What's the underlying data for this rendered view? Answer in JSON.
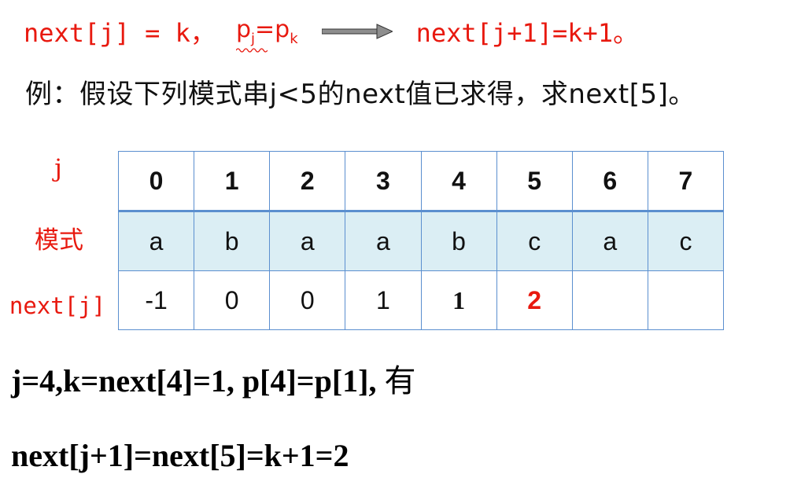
{
  "formula": {
    "left": "next[j] = k，",
    "p": "p",
    "j_sub": "j",
    "eq": "=p",
    "k_sub": "k",
    "right": "next[j+1]=k+1。"
  },
  "example_text": "例：假设下列模式串j<5的next值已求得，求next[5]。",
  "row_labels": {
    "j": "j",
    "pattern": "模式",
    "next": "next[j]"
  },
  "table": {
    "j": [
      "0",
      "1",
      "2",
      "3",
      "4",
      "5",
      "6",
      "7"
    ],
    "pattern": [
      "a",
      "b",
      "a",
      "a",
      "b",
      "c",
      "a",
      "c"
    ],
    "next": [
      "-1",
      "0",
      "0",
      "1",
      "1",
      "2",
      "",
      ""
    ]
  },
  "colors": {
    "red": "#e8190f",
    "grid": "#5b8fcf",
    "pattern_bg": "#dbeef4"
  },
  "equation1": {
    "bold": "j=4,k=next[4]=1, p[4]=p[1],",
    "normal": " 有"
  },
  "equation2": "next[j+1]=next[5]=k+1=2"
}
